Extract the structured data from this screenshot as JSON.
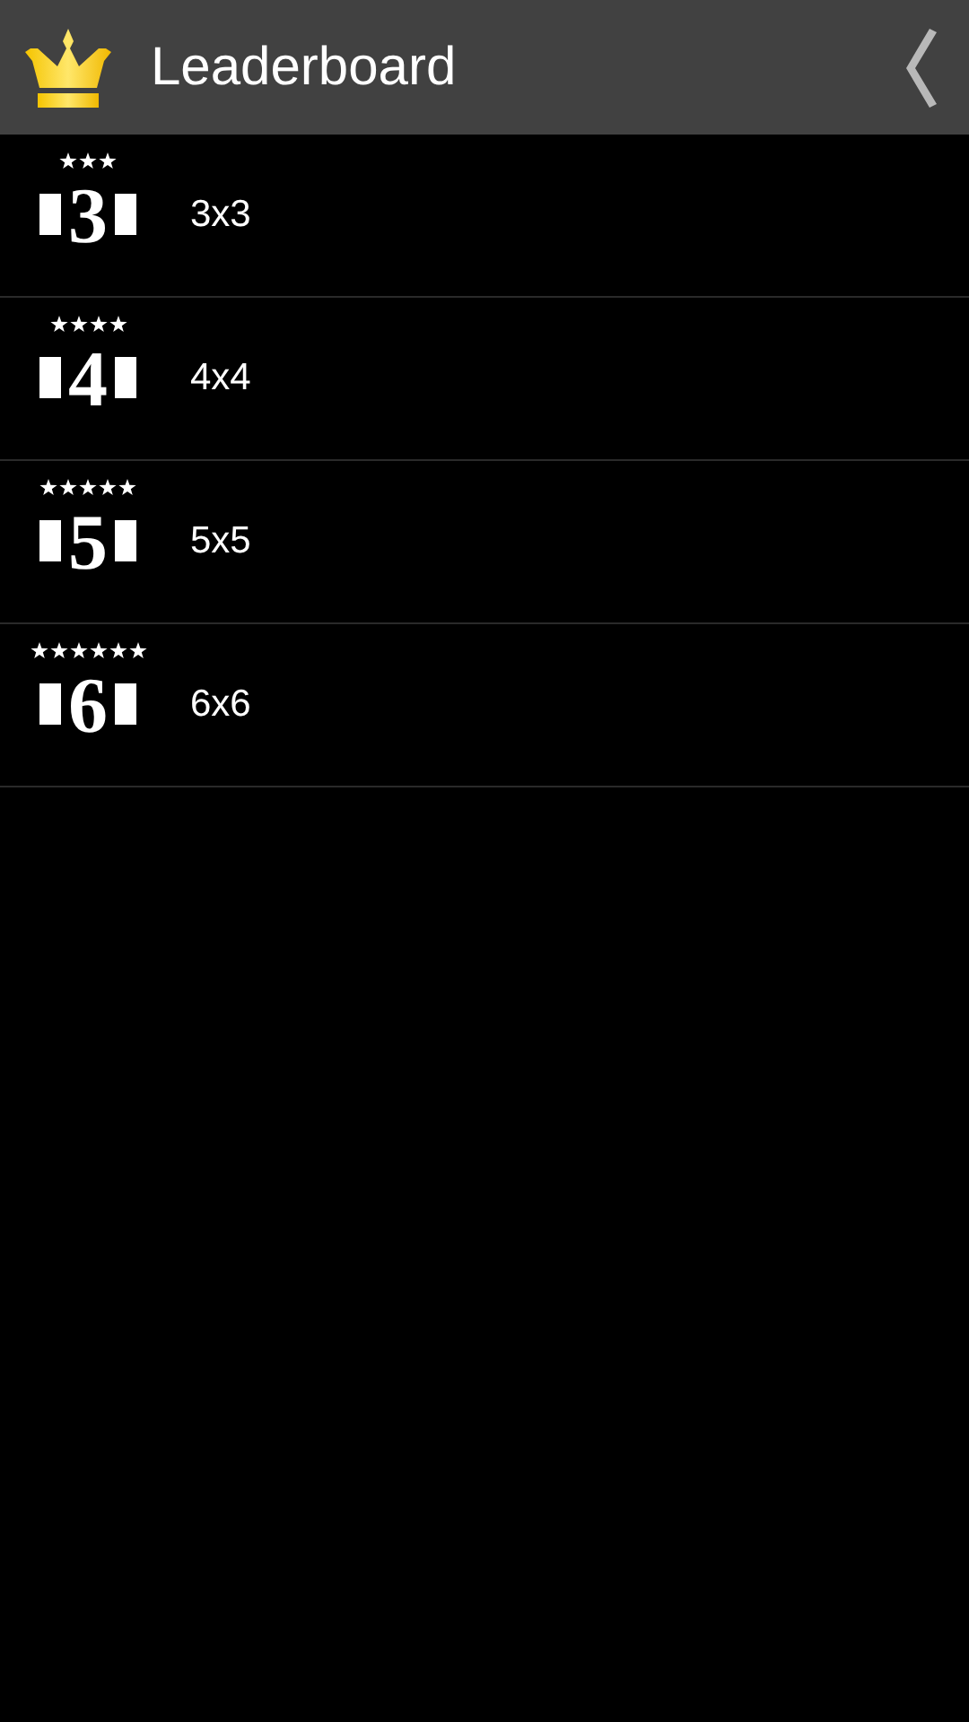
{
  "header": {
    "title": "Leaderboard"
  },
  "boards": [
    {
      "numeral": "3",
      "stars": 3,
      "label": "3x3"
    },
    {
      "numeral": "4",
      "stars": 4,
      "label": "4x4"
    },
    {
      "numeral": "5",
      "stars": 5,
      "label": "5x5"
    },
    {
      "numeral": "6",
      "stars": 6,
      "label": "6x6"
    }
  ]
}
